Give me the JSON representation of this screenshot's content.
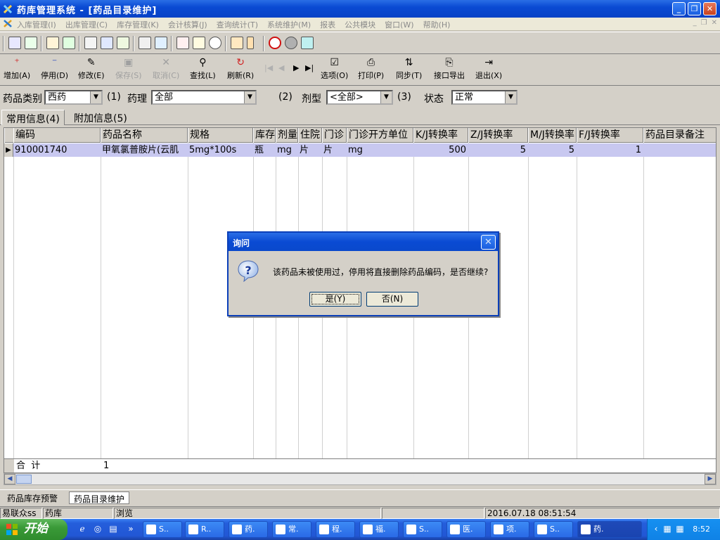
{
  "window": {
    "title": "药库管理系统 - [药品目录维护]"
  },
  "menu": {
    "items": [
      "入库管理(I)",
      "出库管理(C)",
      "库存管理(K)",
      "会计核算(J)",
      "查询统计(T)",
      "系统维护(M)",
      "报表",
      "公共模块",
      "窗口(W)",
      "帮助(H)"
    ]
  },
  "toolbar": {
    "buttons": [
      {
        "label": "增加(A)",
        "icon": "add-icon",
        "enabled": true
      },
      {
        "label": "停用(D)",
        "icon": "disable-icon",
        "enabled": true
      },
      {
        "label": "修改(E)",
        "icon": "edit-icon",
        "enabled": true
      },
      {
        "label": "保存(S)",
        "icon": "save-icon",
        "enabled": false
      },
      {
        "label": "取消(C)",
        "icon": "cancel-icon",
        "enabled": false
      },
      {
        "label": "查找(L)",
        "icon": "search-icon",
        "enabled": true
      },
      {
        "label": "刷新(R)",
        "icon": "refresh-icon",
        "enabled": true
      },
      {
        "label": "选项(O)",
        "icon": "options-icon",
        "enabled": true
      },
      {
        "label": "打印(P)",
        "icon": "print-icon",
        "enabled": true
      },
      {
        "label": "同步(T)",
        "icon": "sync-icon",
        "enabled": true
      },
      {
        "label": "接口导出",
        "icon": "export-icon",
        "enabled": true
      },
      {
        "label": "退出(X)",
        "icon": "exit-icon",
        "enabled": true
      }
    ]
  },
  "filters": {
    "category_label": "药品类别",
    "category_value": "西药",
    "marker1": "(1)",
    "pharmacology_label": "药理",
    "pharmacology_value": "全部",
    "marker2": "(2)",
    "dosage_label": "剂型",
    "dosage_value": "<全部>",
    "marker3": "(3)",
    "status_label": "状态",
    "status_value": "正常"
  },
  "tabs": [
    "常用信息(4)",
    "附加信息(5)"
  ],
  "table": {
    "columns": [
      "编码",
      "药品名称",
      "规格",
      "库存",
      "剂量",
      "住院",
      "门诊",
      "门诊开方单位",
      "K/J转换率",
      "Z/J转换率",
      "M/J转换率",
      "F/J转换率",
      "药品目录备注"
    ],
    "rows": [
      [
        "910001740",
        "甲氧氯普胺片(云肌",
        "5mg*100s",
        "瓶",
        "mg",
        "片",
        "片",
        "mg",
        "500",
        "5",
        "5",
        "1",
        ""
      ]
    ],
    "footer_label": "合  计",
    "footer_count": "1"
  },
  "bottom_tabs": [
    "药品库存预警",
    "药品目录维护"
  ],
  "status": {
    "user": "易联众ss",
    "dept": "药库",
    "mode": "浏览",
    "datetime": "2016.07.18 08:51:54"
  },
  "dialog": {
    "title": "询问",
    "message": "该药品未被使用过，停用将直接删除药品编码，是否继续?",
    "yes": "是(Y)",
    "no": "否(N)"
  },
  "taskbar": {
    "start": "开始",
    "tasks": [
      "S..",
      "R..",
      "药.",
      "常.",
      "程.",
      "福.",
      "S..",
      "医.",
      "项.",
      "S..",
      "药."
    ],
    "clock": "8:52"
  }
}
